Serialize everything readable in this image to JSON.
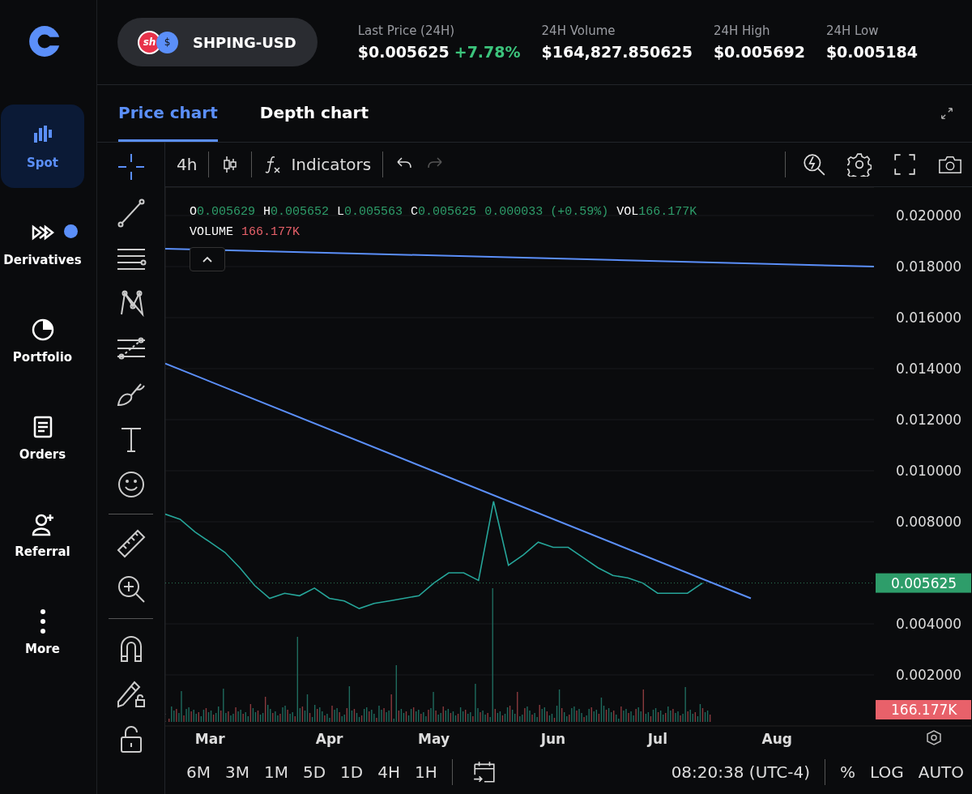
{
  "sidebar": {
    "items": [
      {
        "kind": "spot",
        "label": "Spot",
        "selected": true,
        "notification": false
      },
      {
        "kind": "derivatives",
        "label": "Derivatives",
        "selected": false,
        "notification": true
      },
      {
        "kind": "portfolio",
        "label": "Portfolio",
        "selected": false,
        "notification": false
      },
      {
        "kind": "orders",
        "label": "Orders",
        "selected": false,
        "notification": false
      },
      {
        "kind": "referral",
        "label": "Referral",
        "selected": false,
        "notification": false
      },
      {
        "kind": "more",
        "label": "More",
        "selected": false,
        "notification": false
      }
    ]
  },
  "header": {
    "pair": "SHPING-USD",
    "coin_badge": "sh",
    "quote_badge": "$",
    "stats": [
      {
        "label": "Last Price (24H)",
        "value": "$0.005625",
        "change": "+7.78%"
      },
      {
        "label": "24H Volume",
        "value": "$164,827.850625"
      },
      {
        "label": "24H High",
        "value": "$0.005692"
      },
      {
        "label": "24H Low",
        "value": "$0.005184"
      }
    ]
  },
  "tabs": [
    {
      "label": "Price chart",
      "selected": true
    },
    {
      "label": "Depth chart",
      "selected": false
    }
  ],
  "toolbar": {
    "interval": "4h",
    "indicators": "Indicators",
    "redo_disabled": true
  },
  "tool_groups": [
    {
      "tools": [
        {
          "kind": "crosshair",
          "selected": true
        },
        {
          "kind": "trend-line",
          "selected": false
        },
        {
          "kind": "horizontal-lines",
          "selected": false
        },
        {
          "kind": "pattern",
          "selected": false
        },
        {
          "kind": "fib",
          "selected": false
        },
        {
          "kind": "brush",
          "selected": false
        },
        {
          "kind": "text",
          "selected": false
        },
        {
          "kind": "emoji",
          "selected": false
        }
      ]
    },
    {
      "tools": [
        {
          "kind": "ruler",
          "selected": false
        },
        {
          "kind": "zoom",
          "selected": false
        }
      ]
    },
    {
      "tools": [
        {
          "kind": "magnet",
          "selected": false
        },
        {
          "kind": "lock-draw",
          "selected": false
        },
        {
          "kind": "lock",
          "selected": false
        }
      ]
    }
  ],
  "legend": {
    "ohlc": [
      {
        "key": "O",
        "value": "0.005629"
      },
      {
        "key": "H",
        "value": "0.005652"
      },
      {
        "key": "L",
        "value": "0.005563"
      },
      {
        "key": "C",
        "value": "0.005625"
      }
    ],
    "change": "0.000033 (+0.59%)",
    "vol_label": "VOL",
    "vol_value": "166.177K",
    "volume_label": "VOLUME",
    "volume_value": "166.177K"
  },
  "chart": {
    "price_tag": "0.005625",
    "volume_tag": "166.177K",
    "chart_data": {
      "type": "line",
      "ylim": [
        0,
        0.021
      ],
      "grid": true,
      "categories": [
        null,
        null,
        null,
        "Mar",
        null,
        null,
        null,
        null,
        null,
        null,
        null,
        "Apr",
        null,
        null,
        null,
        null,
        null,
        null,
        "May",
        null,
        null,
        null,
        null,
        null,
        null,
        null,
        "Jun",
        null,
        null,
        null,
        null,
        null,
        null,
        "Jul",
        null,
        null,
        null,
        null,
        null,
        null,
        null,
        "Aug",
        null,
        null,
        null,
        null,
        null,
        null
      ],
      "yticks": [
        {
          "value": 0.002,
          "label": "0.002000"
        },
        {
          "value": 0.004,
          "label": "0.004000"
        },
        {
          "value": 0.008,
          "label": "0.008000"
        },
        {
          "value": 0.01,
          "label": "0.010000"
        },
        {
          "value": 0.012,
          "label": "0.012000"
        },
        {
          "value": 0.014,
          "label": "0.014000"
        },
        {
          "value": 0.016,
          "label": "0.016000"
        },
        {
          "value": 0.018,
          "label": "0.018000"
        },
        {
          "value": 0.02,
          "label": "0.020000"
        }
      ],
      "series": [
        {
          "color": "#26a69a",
          "values": [
            0.0083,
            0.0081,
            0.0076,
            0.0072,
            0.0068,
            0.0062,
            0.0055,
            0.005,
            0.0052,
            0.0051,
            0.0054,
            0.005,
            0.0049,
            0.0046,
            0.0048,
            0.0049,
            0.005,
            0.0051,
            0.0056,
            0.006,
            0.006,
            0.0057,
            0.0088,
            0.0063,
            0.0067,
            0.0072,
            0.007,
            0.007,
            0.0066,
            0.0062,
            0.0059,
            0.0058,
            0.0056,
            0.0052,
            0.0052,
            0.0052,
            0.0056,
            null,
            null,
            null,
            null,
            null,
            null,
            null,
            null,
            null,
            null,
            null
          ]
        }
      ]
    }
  },
  "bottom": {
    "ranges": [
      "6M",
      "3M",
      "1M",
      "5D",
      "1D",
      "4H",
      "1H"
    ],
    "time": "08:20:38 (UTC-4)",
    "options": [
      "%",
      "LOG",
      "AUTO"
    ]
  }
}
